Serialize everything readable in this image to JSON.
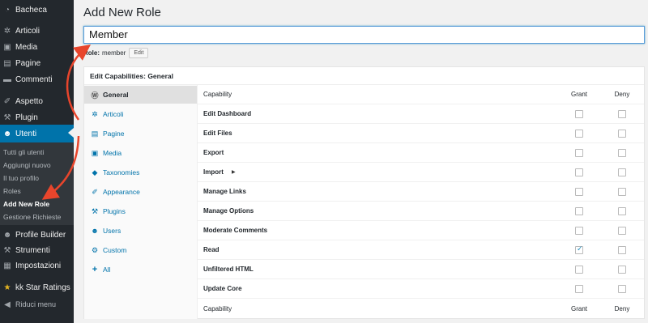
{
  "sidebar": {
    "items": [
      {
        "label": "Bacheca",
        "icon": "dashboard-icon",
        "glyph": "◔",
        "active": false
      },
      {
        "label": "Articoli",
        "icon": "pushpin-icon",
        "glyph": "✲",
        "active": false
      },
      {
        "label": "Media",
        "icon": "media-icon",
        "glyph": "▣",
        "active": false
      },
      {
        "label": "Pagine",
        "icon": "pages-icon",
        "glyph": "▤",
        "active": false
      },
      {
        "label": "Commenti",
        "icon": "comments-icon",
        "glyph": "▬",
        "active": false
      },
      {
        "label": "Aspetto",
        "icon": "brush-icon",
        "glyph": "✐",
        "active": false
      },
      {
        "label": "Plugin",
        "icon": "plugin-icon",
        "glyph": "⚒",
        "active": false
      },
      {
        "label": "Utenti",
        "icon": "users-icon",
        "glyph": "☻",
        "active": true
      },
      {
        "label": "Profile Builder",
        "icon": "user-icon",
        "glyph": "☻",
        "active": false
      },
      {
        "label": "Strumenti",
        "icon": "wrench-icon",
        "glyph": "⚒",
        "active": false
      },
      {
        "label": "Impostazioni",
        "icon": "settings-icon",
        "glyph": "▦",
        "active": false
      },
      {
        "label": "kk Star Ratings",
        "icon": "star-icon",
        "glyph": "★",
        "active": false
      },
      {
        "label": "Riduci menu",
        "icon": "collapse-icon",
        "glyph": "◀",
        "active": false
      }
    ],
    "submenu": [
      {
        "label": "Tutti gli utenti",
        "current": false
      },
      {
        "label": "Aggiungi nuovo",
        "current": false
      },
      {
        "label": "Il tuo profilo",
        "current": false
      },
      {
        "label": "Roles",
        "current": false
      },
      {
        "label": "Add New Role",
        "current": true
      },
      {
        "label": "Gestione Richieste",
        "current": false
      }
    ]
  },
  "page": {
    "title": "Add New Role",
    "role_name_value": "Member",
    "role_slug_label": "Role:",
    "role_slug": "member",
    "edit_button": "Edit"
  },
  "panel": {
    "title": "Edit Capabilities: General",
    "tabs": [
      {
        "label": "General",
        "icon": "wordpress-icon",
        "glyph": "Ⓦ",
        "active": true
      },
      {
        "label": "Articoli",
        "icon": "pushpin-icon",
        "glyph": "✲",
        "active": false
      },
      {
        "label": "Pagine",
        "icon": "pages-icon",
        "glyph": "▤",
        "active": false
      },
      {
        "label": "Media",
        "icon": "media-icon",
        "glyph": "▣",
        "active": false
      },
      {
        "label": "Taxonomies",
        "icon": "tag-icon",
        "glyph": "◆",
        "active": false
      },
      {
        "label": "Appearance",
        "icon": "brush-icon",
        "glyph": "✐",
        "active": false
      },
      {
        "label": "Plugins",
        "icon": "plugin-icon",
        "glyph": "⚒",
        "active": false
      },
      {
        "label": "Users",
        "icon": "users-icon",
        "glyph": "☻",
        "active": false
      },
      {
        "label": "Custom",
        "icon": "gear-icon",
        "glyph": "⚙",
        "active": false
      },
      {
        "label": "All",
        "icon": "plus-icon",
        "glyph": "+",
        "active": false
      }
    ],
    "header": {
      "capability": "Capability",
      "grant": "Grant",
      "deny": "Deny"
    },
    "capabilities": [
      {
        "name": "Edit Dashboard",
        "grant": false,
        "deny": false
      },
      {
        "name": "Edit Files",
        "grant": false,
        "deny": false
      },
      {
        "name": "Export",
        "grant": false,
        "deny": false
      },
      {
        "name": "Import",
        "grant": false,
        "deny": false,
        "expandable": true
      },
      {
        "name": "Manage Links",
        "grant": false,
        "deny": false
      },
      {
        "name": "Manage Options",
        "grant": false,
        "deny": false
      },
      {
        "name": "Moderate Comments",
        "grant": false,
        "deny": false
      },
      {
        "name": "Read",
        "grant": true,
        "deny": false
      },
      {
        "name": "Unfiltered HTML",
        "grant": false,
        "deny": false
      },
      {
        "name": "Update Core",
        "grant": false,
        "deny": false
      }
    ],
    "expand_glyph": "▶"
  },
  "colors": {
    "sidebar": "#23282d",
    "active": "#0073aa",
    "link": "#0073aa",
    "arrow": "#e8452c"
  }
}
